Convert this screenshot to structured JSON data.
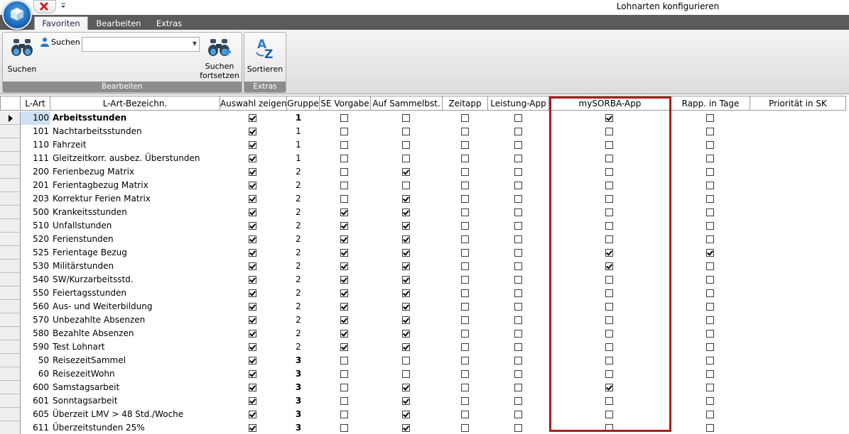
{
  "window": {
    "title": "Lohnarten konfigurieren"
  },
  "ribbon": {
    "tabs": [
      "Favoriten",
      "Bearbeiten",
      "Extras"
    ],
    "active_tab": "Favoriten",
    "groups": {
      "bearbeiten": {
        "label": "Bearbeiten",
        "search_button": "Suchen",
        "search_field_label": "Suchen",
        "search_field_value": "",
        "continue_button_line1": "Suchen",
        "continue_button_line2": "fortsetzen"
      },
      "extras": {
        "label": "Extras",
        "sort_button": "Sortieren"
      }
    }
  },
  "grid": {
    "columns": {
      "lart": "L-Art",
      "bezeichnung": "L-Art-Bezeichn.",
      "auswahl": "Auswahl zeigen",
      "gruppe": "Gruppe",
      "se_vorgabe": "SE Vorgabe",
      "sammelbst": "Auf Sammelbst.",
      "zeitapp": "Zeitapp",
      "leistung_app": "Leistung-App",
      "mysorba_app": "mySORBA-App",
      "rapp_tage": "Rapp. in Tage",
      "prioritaet": "Priorität in SK"
    },
    "rows": [
      {
        "lart": "100",
        "bez": "Arbeitsstunden",
        "auswahl": true,
        "gruppe": "1",
        "se": false,
        "sammel": false,
        "zeit": false,
        "leistung": false,
        "mysorba": true,
        "rapp": false
      },
      {
        "lart": "101",
        "bez": "Nachtarbeitsstunden",
        "auswahl": true,
        "gruppe": "1",
        "se": false,
        "sammel": false,
        "zeit": false,
        "leistung": false,
        "mysorba": false,
        "rapp": false
      },
      {
        "lart": "110",
        "bez": "Fahrzeit",
        "auswahl": true,
        "gruppe": "1",
        "se": false,
        "sammel": false,
        "zeit": false,
        "leistung": false,
        "mysorba": false,
        "rapp": false
      },
      {
        "lart": "111",
        "bez": "Gleitzeitkorr. ausbez. Überstunden",
        "auswahl": true,
        "gruppe": "1",
        "se": false,
        "sammel": false,
        "zeit": false,
        "leistung": false,
        "mysorba": false,
        "rapp": false
      },
      {
        "lart": "200",
        "bez": "Ferienbezug Matrix",
        "auswahl": true,
        "gruppe": "2",
        "se": false,
        "sammel": true,
        "zeit": false,
        "leistung": false,
        "mysorba": false,
        "rapp": false
      },
      {
        "lart": "201",
        "bez": "Ferientagbezug Matrix",
        "auswahl": true,
        "gruppe": "2",
        "se": false,
        "sammel": false,
        "zeit": false,
        "leistung": false,
        "mysorba": false,
        "rapp": false
      },
      {
        "lart": "203",
        "bez": "Korrektur Ferien Matrix",
        "auswahl": true,
        "gruppe": "2",
        "se": false,
        "sammel": true,
        "zeit": false,
        "leistung": false,
        "mysorba": false,
        "rapp": false
      },
      {
        "lart": "500",
        "bez": "Krankeitsstunden",
        "auswahl": true,
        "gruppe": "2",
        "se": true,
        "sammel": true,
        "zeit": false,
        "leistung": false,
        "mysorba": false,
        "rapp": false
      },
      {
        "lart": "510",
        "bez": "Unfallstunden",
        "auswahl": true,
        "gruppe": "2",
        "se": true,
        "sammel": true,
        "zeit": false,
        "leistung": false,
        "mysorba": false,
        "rapp": false
      },
      {
        "lart": "520",
        "bez": "Ferienstunden",
        "auswahl": true,
        "gruppe": "2",
        "se": true,
        "sammel": true,
        "zeit": false,
        "leistung": false,
        "mysorba": false,
        "rapp": false
      },
      {
        "lart": "525",
        "bez": "Ferientage Bezug",
        "auswahl": true,
        "gruppe": "2",
        "se": true,
        "sammel": true,
        "zeit": false,
        "leistung": false,
        "mysorba": true,
        "rapp": true
      },
      {
        "lart": "530",
        "bez": "Militärstunden",
        "auswahl": true,
        "gruppe": "2",
        "se": true,
        "sammel": true,
        "zeit": false,
        "leistung": false,
        "mysorba": true,
        "rapp": false
      },
      {
        "lart": "540",
        "bez": "SW/Kurzarbeitsstd.",
        "auswahl": true,
        "gruppe": "2",
        "se": true,
        "sammel": true,
        "zeit": false,
        "leistung": false,
        "mysorba": false,
        "rapp": false
      },
      {
        "lart": "550",
        "bez": "Feiertagsstunden",
        "auswahl": true,
        "gruppe": "2",
        "se": true,
        "sammel": true,
        "zeit": false,
        "leistung": false,
        "mysorba": false,
        "rapp": false
      },
      {
        "lart": "560",
        "bez": "Aus- und Weiterbildung",
        "auswahl": true,
        "gruppe": "2",
        "se": true,
        "sammel": true,
        "zeit": false,
        "leistung": false,
        "mysorba": false,
        "rapp": false
      },
      {
        "lart": "570",
        "bez": "Unbezahlte Absenzen",
        "auswahl": true,
        "gruppe": "2",
        "se": true,
        "sammel": true,
        "zeit": false,
        "leistung": false,
        "mysorba": false,
        "rapp": false
      },
      {
        "lart": "580",
        "bez": "Bezahlte Absenzen",
        "auswahl": true,
        "gruppe": "2",
        "se": true,
        "sammel": true,
        "zeit": false,
        "leistung": false,
        "mysorba": false,
        "rapp": false
      },
      {
        "lart": "590",
        "bez": "Test Lohnart",
        "auswahl": true,
        "gruppe": "2",
        "se": true,
        "sammel": true,
        "zeit": false,
        "leistung": false,
        "mysorba": false,
        "rapp": false
      },
      {
        "lart": "50",
        "bez": "ReisezeitSammel",
        "auswahl": true,
        "gruppe": "3",
        "se": false,
        "sammel": false,
        "zeit": false,
        "leistung": false,
        "mysorba": false,
        "rapp": false
      },
      {
        "lart": "60",
        "bez": "ReisezeitWohn",
        "auswahl": true,
        "gruppe": "3",
        "se": false,
        "sammel": false,
        "zeit": false,
        "leistung": false,
        "mysorba": false,
        "rapp": false
      },
      {
        "lart": "600",
        "bez": "Samstagsarbeit",
        "auswahl": true,
        "gruppe": "3",
        "se": false,
        "sammel": true,
        "zeit": false,
        "leistung": false,
        "mysorba": true,
        "rapp": false
      },
      {
        "lart": "601",
        "bez": "Sonntagsarbeit",
        "auswahl": true,
        "gruppe": "3",
        "se": false,
        "sammel": true,
        "zeit": false,
        "leistung": false,
        "mysorba": false,
        "rapp": false
      },
      {
        "lart": "605",
        "bez": "Überzeit LMV > 48 Std./Woche",
        "auswahl": true,
        "gruppe": "3",
        "se": false,
        "sammel": true,
        "zeit": false,
        "leistung": false,
        "mysorba": false,
        "rapp": false
      },
      {
        "lart": "611",
        "bez": "Überzeitstunden 25%",
        "auswahl": true,
        "gruppe": "3",
        "se": false,
        "sammel": true,
        "zeit": false,
        "leistung": false,
        "mysorba": false,
        "rapp": false
      }
    ],
    "selected_row": 0,
    "highlight_color": "#b01c1c"
  }
}
